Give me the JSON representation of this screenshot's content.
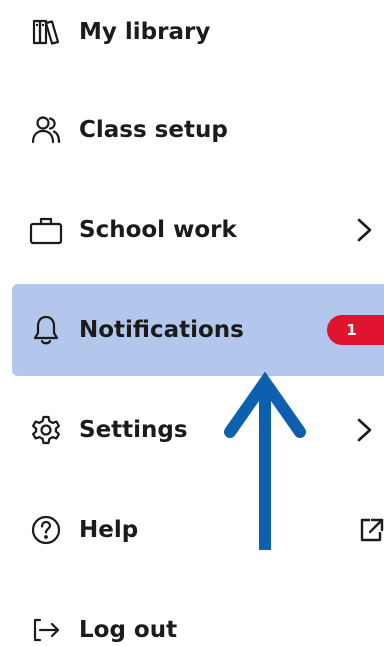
{
  "menu": {
    "items": [
      {
        "id": "my-library",
        "label": "My library",
        "icon": "library-books-icon"
      },
      {
        "id": "class-setup",
        "label": "Class setup",
        "icon": "people-icon"
      },
      {
        "id": "school-work",
        "label": "School work",
        "icon": "briefcase-icon",
        "trailing": "chevron-right-icon"
      },
      {
        "id": "notifications",
        "label": "Notifications",
        "icon": "bell-icon",
        "badge": "1",
        "active": true
      },
      {
        "id": "settings",
        "label": "Settings",
        "icon": "gear-icon",
        "trailing": "chevron-right-icon"
      },
      {
        "id": "help",
        "label": "Help",
        "icon": "question-circle-icon",
        "trailing": "external-link-icon"
      },
      {
        "id": "log-out",
        "label": "Log out",
        "icon": "logout-icon"
      }
    ]
  },
  "colors": {
    "active_bg": "#b3c6ec",
    "badge_bg": "#e0142f",
    "annotation_arrow": "#0d5fb0",
    "text": "#1b1b1b"
  },
  "annotation": {
    "icon": "up-arrow-annotation",
    "points_to": "notifications"
  }
}
